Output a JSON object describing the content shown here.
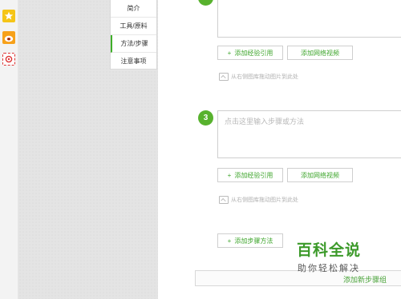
{
  "share_bar": {
    "icons": [
      "star-icon",
      "weibo-icon",
      "tencent-weibo-icon"
    ],
    "star_color": "#f5c518",
    "weibo_color": "#f7a11a"
  },
  "side_menu": {
    "items": [
      {
        "label": "简介"
      },
      {
        "label": "工具/原料"
      },
      {
        "label": "方法/步骤"
      },
      {
        "label": "注意事项"
      }
    ],
    "active_index": 2,
    "accent": "#3fae2a"
  },
  "step_top": {
    "add_ref_label": "添加经验引用",
    "add_video_label": "添加网络视频",
    "hint": "从右侧图库拖动图片到此处"
  },
  "step_three": {
    "number": "3",
    "placeholder": "点击这里输入步骤或方法",
    "add_ref_label": "添加经验引用",
    "add_video_label": "添加网络视频",
    "hint": "从右侧图库拖动图片到此处"
  },
  "add_step": {
    "label": "添加步骤方法"
  },
  "bottom_bar": {
    "label": "添加新步骤组"
  },
  "watermark": {
    "title": "百科全说",
    "subtitle": "助你轻松解决"
  }
}
